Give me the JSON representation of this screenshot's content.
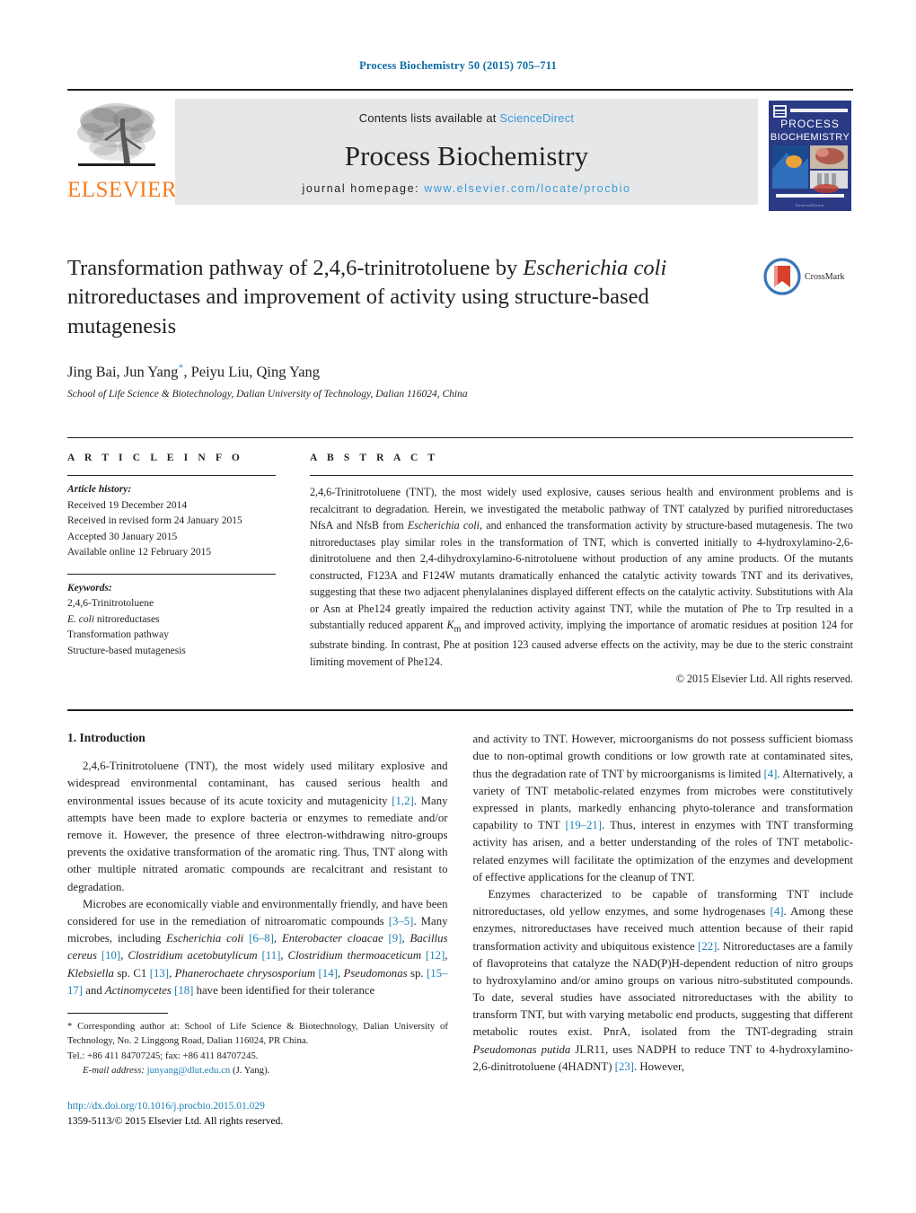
{
  "running_head": "Process Biochemistry 50 (2015) 705–711",
  "masthead": {
    "publisher_name": "ELSEVIER",
    "contents_prefix": "Contents lists available at ",
    "contents_link": "ScienceDirect",
    "journal_name": "Process Biochemistry",
    "homepage_prefix": "journal homepage: ",
    "homepage_url": "www.elsevier.com/locate/procbio",
    "cover_title_line1": "PROCESS",
    "cover_title_line2": "BIOCHEMISTRY"
  },
  "article": {
    "title_part1": "Transformation pathway of 2,4,6-trinitrotoluene by ",
    "title_italic": "Escherichia coli",
    "title_part2": " nitroreductases and improvement of activity using structure-based mutagenesis",
    "authors": "Jing Bai, Jun Yang",
    "authors_tail": ", Peiyu Liu, Qing Yang",
    "corresponding_marker": "*",
    "affiliation": "School of Life Science & Biotechnology, Dalian University of Technology, Dalian 116024, China",
    "crossmark_label": "CrossMark"
  },
  "article_info": {
    "heading": "A R T I C L E   I N F O",
    "history_label": "Article history:",
    "history": [
      "Received 19 December 2014",
      "Received in revised form 24 January 2015",
      "Accepted 30 January 2015",
      "Available online 12 February 2015"
    ],
    "keywords_label": "Keywords:",
    "keywords": [
      "2,4,6-Trinitrotoluene",
      "E. coli nitroreductases",
      "Transformation pathway",
      "Structure-based mutagenesis"
    ],
    "keyword_italic_prefix": "E. coli",
    "keyword_italic_rest": " nitroreductases"
  },
  "abstract": {
    "heading": "A B S T R A C T",
    "p1": "2,4,6-Trinitrotoluene (TNT), the most widely used explosive, causes serious health and environment problems and is recalcitrant to degradation. Herein, we investigated the metabolic pathway of TNT catalyzed by purified nitroreductases NfsA and NfsB from ",
    "italic1": "Escherichia coli",
    "p2": ", and enhanced the transformation activity by structure-based mutagenesis. The two nitroreductases play similar roles in the transformation of TNT, which is converted initially to 4-hydroxylamino-2,6-dinitrotoluene and then 2,4-dihydroxylamino-6-nitrotoluene without production of any amine products. Of the mutants constructed, F123A and F124W mutants dramatically enhanced the catalytic activity towards TNT and its derivatives, suggesting that these two adjacent phenylalanines displayed different effects on the catalytic activity. Substitutions with Ala or Asn at Phe124 greatly impaired the reduction activity against TNT, while the mutation of Phe to Trp resulted in a substantially reduced apparent ",
    "italic2": "K",
    "sub2": "m",
    "p3": " and improved activity, implying the importance of aromatic residues at position 124 for substrate binding. In contrast, Phe at position 123 caused adverse effects on the activity, may be due to the steric constraint limiting movement of Phe124.",
    "copyright": "© 2015 Elsevier Ltd. All rights reserved."
  },
  "introduction": {
    "heading": "1. Introduction",
    "left": {
      "p1_a": "2,4,6-Trinitrotoluene (TNT), the most widely used military explosive and widespread environmental contaminant, has caused serious health and environmental issues because of its acute toxicity and mutagenicity ",
      "p1_ref1": "[1,2]",
      "p1_b": ". Many attempts have been made to explore bacteria or enzymes to remediate and/or remove it. However, the presence of three electron-withdrawing nitro-groups prevents the oxidative transformation of the aromatic ring. Thus, TNT along with other multiple nitrated aromatic compounds are recalcitrant and resistant to degradation.",
      "p2_a": "Microbes are economically viable and environmentally friendly, and have been considered for use in the remediation of nitroaromatic compounds ",
      "p2_ref1": "[3–5]",
      "p2_b": ". Many microbes, including ",
      "p2_i1": "Escherichia coli",
      "p2_ref2": "[6–8]",
      "p2_c": ", ",
      "p2_i2": "Enterobacter cloacae",
      "p2_ref3": "[9]",
      "p2_i3": "Bacillus cereus",
      "p2_ref4": "[10]",
      "p2_i4": "Clostridium acetobutylicum",
      "p2_ref5": "[11]",
      "p2_i5": "Clostridium thermoaceticum",
      "p2_ref6": "[12]",
      "p2_i6": "Klebsiella",
      "p2_d": " sp. C1 ",
      "p2_ref7": "[13]",
      "p2_i7": "Phanerochaete chrysosporium",
      "p2_ref8": "[14]",
      "p2_i8": "Pseudomonas",
      "p2_e": " sp. ",
      "p2_ref9": "[15–17]",
      "p2_f": " and ",
      "p2_i9": "Actinomycetes",
      "p2_ref10": "[18]",
      "p2_g": " have been identified for their tolerance"
    },
    "right": {
      "p1_a": "and activity to TNT. However, microorganisms do not possess sufficient biomass due to non-optimal growth conditions or low growth rate at contaminated sites, thus the degradation rate of TNT by microorganisms is limited ",
      "p1_ref1": "[4]",
      "p1_b": ". Alternatively, a variety of TNT metabolic-related enzymes from microbes were constitutively expressed in plants, markedly enhancing phyto-tolerance and transformation capability to TNT ",
      "p1_ref2": "[19–21]",
      "p1_c": ". Thus, interest in enzymes with TNT transforming activity has arisen, and a better understanding of the roles of TNT metabolic-related enzymes will facilitate the optimization of the enzymes and development of effective applications for the cleanup of TNT.",
      "p2_a": "Enzymes characterized to be capable of transforming TNT include nitroreductases, old yellow enzymes, and some hydrogenases ",
      "p2_ref1": "[4]",
      "p2_b": ". Among these enzymes, nitroreductases have received much attention because of their rapid transformation activity and ubiquitous existence ",
      "p2_ref2": "[22]",
      "p2_c": ". Nitroreductases are a family of flavoproteins that catalyze the NAD(P)H-dependent reduction of nitro groups to hydroxylamino and/or amino groups on various nitro-substituted compounds. To date, several studies have associated nitroreductases with the ability to transform TNT, but with varying metabolic end products, suggesting that different metabolic routes exist. PnrA, isolated from the TNT-degrading strain ",
      "p2_i1": "Pseudomonas putida",
      "p2_d": " JLR11, uses NADPH to reduce TNT to 4-hydroxylamino-2,6-dinitrotoluene (4HADNT) ",
      "p2_ref3": "[23]",
      "p2_e": ". However,"
    }
  },
  "footnote": {
    "corresponding": "* Corresponding author at: School of Life Science & Biotechnology, Dalian University of Technology, No. 2 Linggong Road, Dalian 116024, PR China.",
    "phone": "Tel.: +86 411 84707245; fax: +86 411 84707245.",
    "email_label": "E-mail address:",
    "email": "junyang@dlut.edu.cn",
    "email_owner": "(J. Yang).",
    "doi": "http://dx.doi.org/10.1016/j.procbio.2015.01.029",
    "issn_line": "1359-5113/© 2015 Elsevier Ltd. All rights reserved."
  },
  "colors": {
    "running_head": "#0b6ca3",
    "link": "#1a7fb5",
    "sciencedirect": "#3a9ad9",
    "elsevier_orange": "#f47c20",
    "band_gray": "#e6e7e8",
    "text": "#231f20"
  }
}
